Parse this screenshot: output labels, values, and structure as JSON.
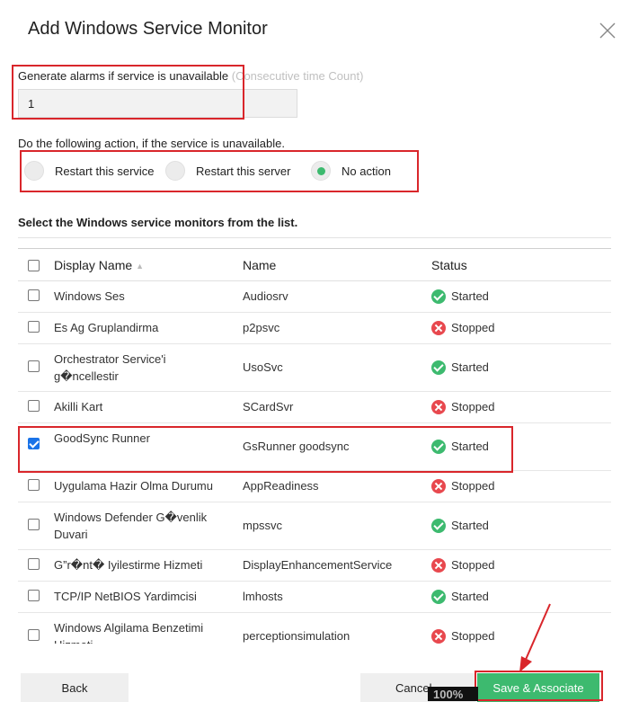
{
  "dialog": {
    "title": "Add Windows Service Monitor"
  },
  "alarm": {
    "label": "Generate alarms if service is unavailable",
    "hint": "(Consecutive time Count)",
    "value": "1"
  },
  "action": {
    "label": "Do the following action, if the service is unavailable.",
    "options": [
      {
        "label": "Restart this service",
        "selected": false
      },
      {
        "label": "Restart this server",
        "selected": false
      },
      {
        "label": "No action",
        "selected": true
      }
    ]
  },
  "list": {
    "heading": "Select the Windows service monitors from the list."
  },
  "table": {
    "headers": {
      "display_name": "Display Name",
      "name": "Name",
      "status": "Status"
    },
    "rows": [
      {
        "display": "Windows Ses",
        "name": "Audiosrv",
        "status": "Started",
        "checked": false
      },
      {
        "display": "Es Ag Gruplandirma",
        "name": "p2psvc",
        "status": "Stopped",
        "checked": false
      },
      {
        "display": "Orchestrator Service'i g�ncellestir",
        "name": "UsoSvc",
        "status": "Started",
        "checked": false
      },
      {
        "display": "Akilli Kart",
        "name": "SCardSvr",
        "status": "Stopped",
        "checked": false
      },
      {
        "display": "GoodSync Runner",
        "name": "GsRunner goodsync",
        "status": "Started",
        "checked": true
      },
      {
        "display": "Uygulama Hazir Olma Durumu",
        "name": "AppReadiness",
        "status": "Stopped",
        "checked": false
      },
      {
        "display": "Windows Defender G�venlik Duvari",
        "name": "mpssvc",
        "status": "Started",
        "checked": false
      },
      {
        "display": "G”r�nt� Iyilestirme Hizmeti",
        "name": "DisplayEnhancementService",
        "status": "Stopped",
        "checked": false
      },
      {
        "display": "TCP/IP NetBIOS Yardimcisi",
        "name": "lmhosts",
        "status": "Started",
        "checked": false
      },
      {
        "display": "Windows Algilama Benzetimi Hizmeti",
        "name": "perceptionsimulation",
        "status": "Stopped",
        "checked": false
      }
    ]
  },
  "footer": {
    "back": "Back",
    "cancel": "Cancel",
    "save": "Save & Associate",
    "zoom": "100%"
  },
  "colors": {
    "accent_green": "#3dba6f",
    "stopped_red": "#e8484e",
    "annotation_red": "#d9262b"
  }
}
